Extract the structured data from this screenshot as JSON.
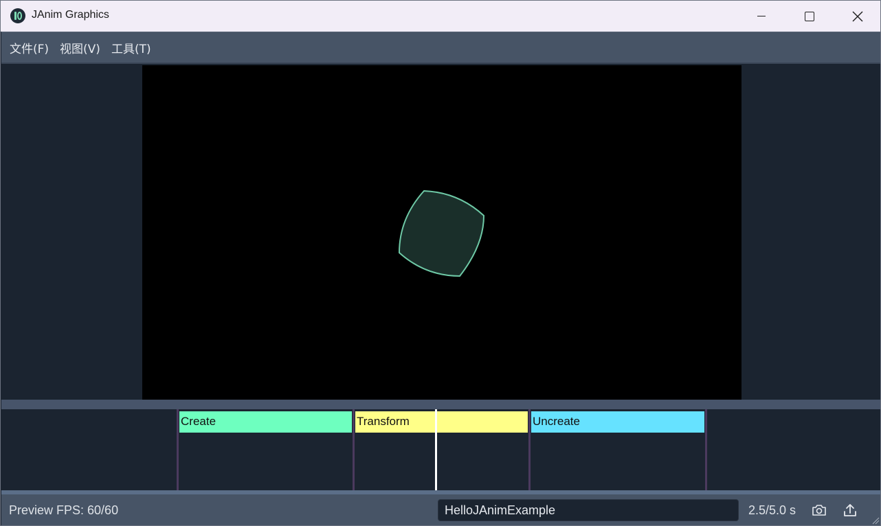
{
  "window": {
    "title": "JAnim Graphics"
  },
  "menu": [
    {
      "label": "文件(F)"
    },
    {
      "label": "视图(V)"
    },
    {
      "label": "工具(T)"
    }
  ],
  "timeline": {
    "blocks": [
      {
        "label": "Create",
        "color": "#6effbf"
      },
      {
        "label": "Transform",
        "color": "#ffff88"
      },
      {
        "label": "Uncreate",
        "color": "#66e2ff"
      }
    ],
    "cursor_time": 2.5
  },
  "status": {
    "fps_text": "Preview FPS: 60/60",
    "scene_name": "HelloJAnimExample",
    "time_text": "2.5/5.0 s"
  },
  "colors": {
    "shape_stroke": "#6ec9a6",
    "shape_fill": "#1a2f2a",
    "menubar": "#475466",
    "background": "#1b2430"
  },
  "icons": [
    "app-logo-icon",
    "minimize-icon",
    "maximize-icon",
    "close-icon",
    "camera-icon",
    "export-icon",
    "resize-grip-icon"
  ]
}
